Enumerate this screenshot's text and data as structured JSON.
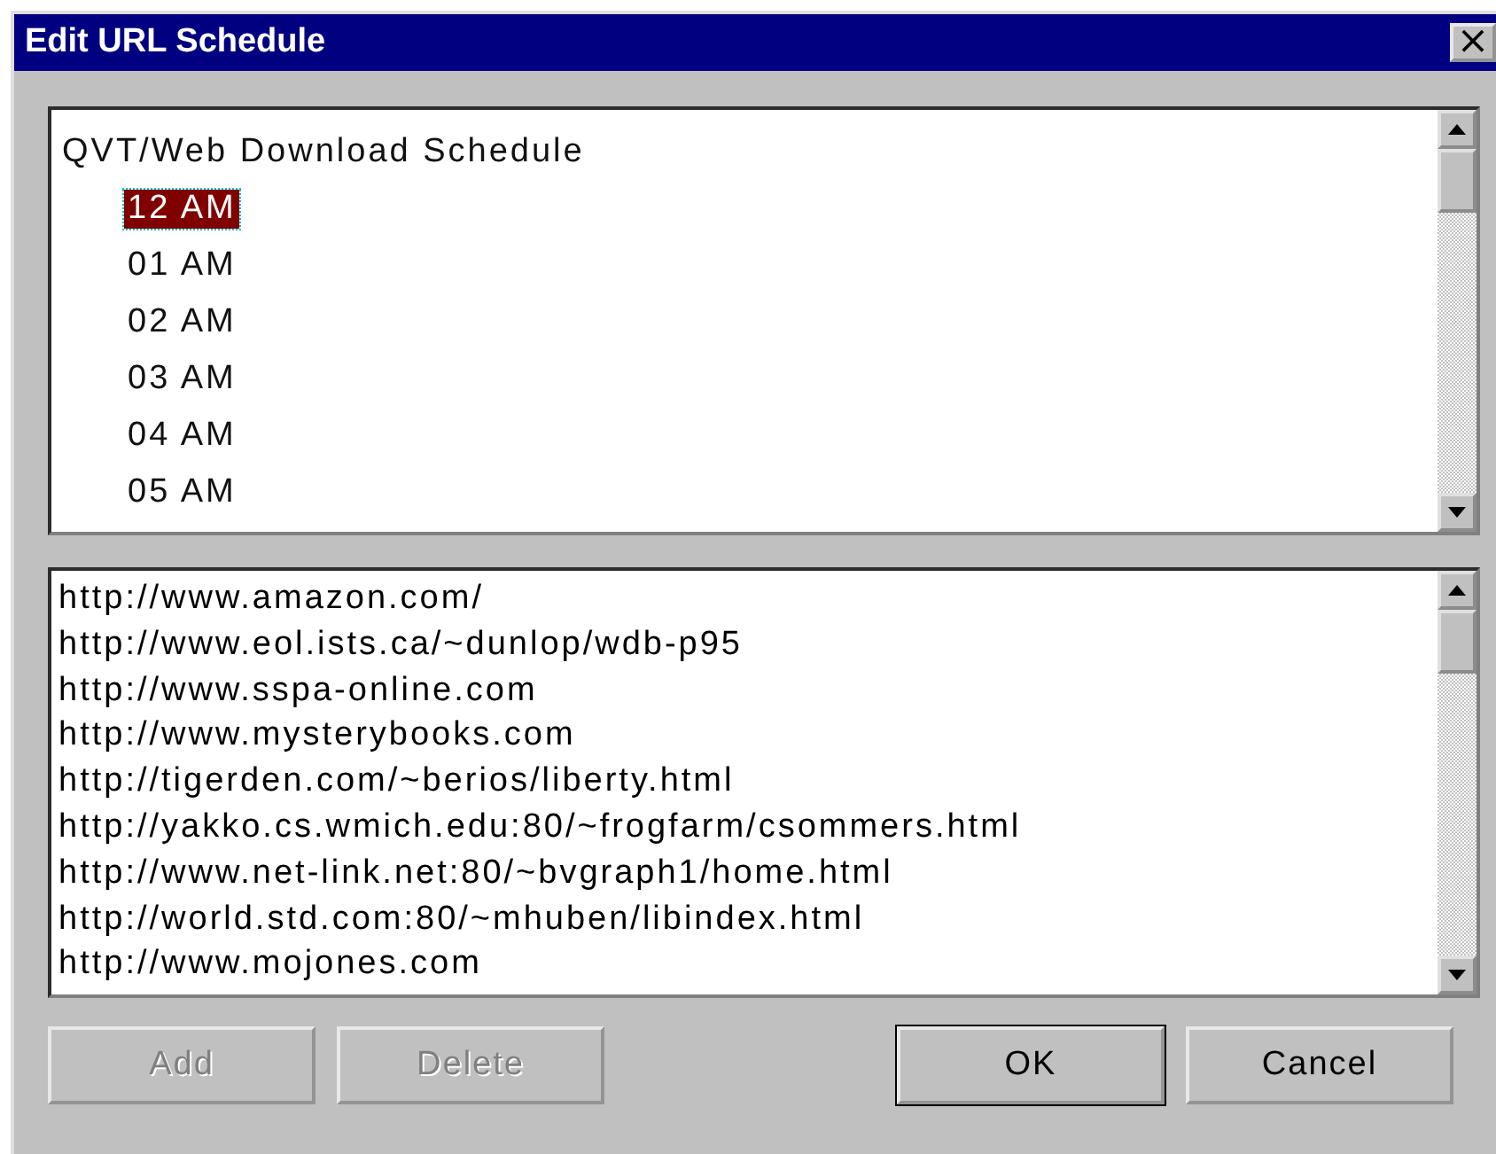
{
  "window": {
    "title": "Edit URL Schedule",
    "close_glyph": "×"
  },
  "schedule": {
    "label": "QVT/Web Download Schedule",
    "children": [
      {
        "label": "12 AM",
        "selected": true
      },
      {
        "label": "01 AM",
        "selected": false
      },
      {
        "label": "02 AM",
        "selected": false
      },
      {
        "label": "03 AM",
        "selected": false
      },
      {
        "label": "04 AM",
        "selected": false
      },
      {
        "label": "05 AM",
        "selected": false
      }
    ]
  },
  "urls": [
    "http://www.amazon.com/",
    "http://www.eol.ists.ca/~dunlop/wdb-p95",
    "http://www.sspa-online.com",
    "http://www.mysterybooks.com",
    "http://tigerden.com/~berios/liberty.html",
    "http://yakko.cs.wmich.edu:80/~frogfarm/csommers.html",
    "http://www.net-link.net:80/~bvgraph1/home.html",
    "http://world.std.com:80/~mhuben/libindex.html",
    "http://www.mojones.com"
  ],
  "buttons": [
    {
      "label": "Add",
      "disabled": true,
      "default": false
    },
    {
      "label": "Delete",
      "disabled": true,
      "default": false
    },
    {
      "label": "OK",
      "disabled": false,
      "default": true
    },
    {
      "label": "Cancel",
      "disabled": false,
      "default": false
    }
  ]
}
